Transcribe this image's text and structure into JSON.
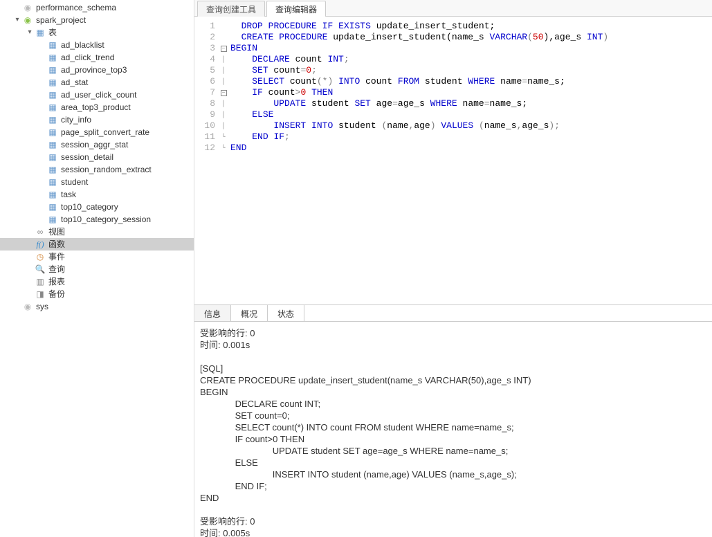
{
  "sidebar": {
    "nodes": [
      {
        "indent": 1,
        "toggle": "",
        "icon": "db-gray",
        "label": "performance_schema"
      },
      {
        "indent": 1,
        "toggle": "▾",
        "icon": "db",
        "label": "spark_project"
      },
      {
        "indent": 2,
        "toggle": "▾",
        "icon": "table-grp",
        "label": "表"
      },
      {
        "indent": 3,
        "toggle": "",
        "icon": "table",
        "label": "ad_blacklist"
      },
      {
        "indent": 3,
        "toggle": "",
        "icon": "table",
        "label": "ad_click_trend"
      },
      {
        "indent": 3,
        "toggle": "",
        "icon": "table",
        "label": "ad_province_top3"
      },
      {
        "indent": 3,
        "toggle": "",
        "icon": "table",
        "label": "ad_stat"
      },
      {
        "indent": 3,
        "toggle": "",
        "icon": "table",
        "label": "ad_user_click_count"
      },
      {
        "indent": 3,
        "toggle": "",
        "icon": "table",
        "label": "area_top3_product"
      },
      {
        "indent": 3,
        "toggle": "",
        "icon": "table",
        "label": "city_info"
      },
      {
        "indent": 3,
        "toggle": "",
        "icon": "table",
        "label": "page_split_convert_rate"
      },
      {
        "indent": 3,
        "toggle": "",
        "icon": "table",
        "label": "session_aggr_stat"
      },
      {
        "indent": 3,
        "toggle": "",
        "icon": "table",
        "label": "session_detail"
      },
      {
        "indent": 3,
        "toggle": "",
        "icon": "table",
        "label": "session_random_extract"
      },
      {
        "indent": 3,
        "toggle": "",
        "icon": "table",
        "label": "student"
      },
      {
        "indent": 3,
        "toggle": "",
        "icon": "table",
        "label": "task"
      },
      {
        "indent": 3,
        "toggle": "",
        "icon": "table",
        "label": "top10_category"
      },
      {
        "indent": 3,
        "toggle": "",
        "icon": "table",
        "label": "top10_category_session"
      },
      {
        "indent": 2,
        "toggle": "",
        "icon": "view",
        "label": "视图"
      },
      {
        "indent": 2,
        "toggle": "",
        "icon": "func",
        "label": "函数",
        "selected": true
      },
      {
        "indent": 2,
        "toggle": "",
        "icon": "event",
        "label": "事件"
      },
      {
        "indent": 2,
        "toggle": "",
        "icon": "query",
        "label": "查询"
      },
      {
        "indent": 2,
        "toggle": "",
        "icon": "report",
        "label": "报表"
      },
      {
        "indent": 2,
        "toggle": "",
        "icon": "backup",
        "label": "备份"
      },
      {
        "indent": 1,
        "toggle": "",
        "icon": "db-gray",
        "label": "sys"
      }
    ]
  },
  "topTabs": [
    {
      "label": "查询创建工具",
      "active": false
    },
    {
      "label": "查询编辑器",
      "active": true
    }
  ],
  "editor": {
    "lines": [
      {
        "n": 1,
        "fold": "",
        "tokens": [
          [
            "  ",
            "pl"
          ],
          [
            "DROP",
            "kw"
          ],
          [
            " ",
            "pl"
          ],
          [
            "PROCEDURE",
            "kw"
          ],
          [
            " ",
            "pl"
          ],
          [
            "IF",
            "kw"
          ],
          [
            " ",
            "pl"
          ],
          [
            "EXISTS",
            "kw"
          ],
          [
            " update_insert_student;",
            "id"
          ]
        ]
      },
      {
        "n": 2,
        "fold": "",
        "tokens": [
          [
            "  ",
            "pl"
          ],
          [
            "CREATE",
            "kw"
          ],
          [
            " ",
            "pl"
          ],
          [
            "PROCEDURE",
            "kw"
          ],
          [
            " update_insert_student(name_s ",
            "id"
          ],
          [
            "VARCHAR",
            "type"
          ],
          [
            "(",
            "op"
          ],
          [
            "50",
            "num"
          ],
          [
            "),age_s ",
            "id"
          ],
          [
            "INT",
            "type"
          ],
          [
            ")",
            "op"
          ]
        ]
      },
      {
        "n": 3,
        "fold": "box",
        "tokens": [
          [
            "BEGIN",
            "kw"
          ]
        ]
      },
      {
        "n": 4,
        "fold": "line",
        "tokens": [
          [
            "    ",
            "pl"
          ],
          [
            "DECLARE",
            "kw"
          ],
          [
            " count ",
            "id"
          ],
          [
            "INT",
            "type"
          ],
          [
            ";",
            "op"
          ]
        ]
      },
      {
        "n": 5,
        "fold": "line",
        "tokens": [
          [
            "    ",
            "pl"
          ],
          [
            "SET",
            "kw"
          ],
          [
            " count",
            "id"
          ],
          [
            "=",
            "op"
          ],
          [
            "0",
            "num"
          ],
          [
            ";",
            "op"
          ]
        ]
      },
      {
        "n": 6,
        "fold": "line",
        "tokens": [
          [
            "    ",
            "pl"
          ],
          [
            "SELECT",
            "kw"
          ],
          [
            " count",
            "id"
          ],
          [
            "(*) ",
            "op"
          ],
          [
            "INTO",
            "kw"
          ],
          [
            " count ",
            "id"
          ],
          [
            "FROM",
            "kw"
          ],
          [
            " student ",
            "id"
          ],
          [
            "WHERE",
            "kw"
          ],
          [
            " name",
            "id"
          ],
          [
            "=",
            "op"
          ],
          [
            "name_s;",
            "id"
          ]
        ]
      },
      {
        "n": 7,
        "fold": "box",
        "tokens": [
          [
            "    ",
            "pl"
          ],
          [
            "IF",
            "kw"
          ],
          [
            " count",
            "id"
          ],
          [
            ">",
            "op"
          ],
          [
            "0",
            "num"
          ],
          [
            " ",
            "pl"
          ],
          [
            "THEN",
            "kw"
          ]
        ]
      },
      {
        "n": 8,
        "fold": "line",
        "tokens": [
          [
            "        ",
            "pl"
          ],
          [
            "UPDATE",
            "kw"
          ],
          [
            " student ",
            "id"
          ],
          [
            "SET",
            "kw"
          ],
          [
            " age",
            "id"
          ],
          [
            "=",
            "op"
          ],
          [
            "age_s ",
            "id"
          ],
          [
            "WHERE",
            "kw"
          ],
          [
            " name",
            "id"
          ],
          [
            "=",
            "op"
          ],
          [
            "name_s;",
            "id"
          ]
        ]
      },
      {
        "n": 9,
        "fold": "line",
        "tokens": [
          [
            "    ",
            "pl"
          ],
          [
            "ELSE",
            "kw"
          ]
        ]
      },
      {
        "n": 10,
        "fold": "line",
        "tokens": [
          [
            "        ",
            "pl"
          ],
          [
            "INSERT",
            "kw"
          ],
          [
            " ",
            "pl"
          ],
          [
            "INTO",
            "kw"
          ],
          [
            " student ",
            "id"
          ],
          [
            "(",
            "op"
          ],
          [
            "name",
            "id"
          ],
          [
            ",",
            "op"
          ],
          [
            "age",
            "id"
          ],
          [
            ") ",
            "op"
          ],
          [
            "VALUES",
            "kw"
          ],
          [
            " ",
            "pl"
          ],
          [
            "(",
            "op"
          ],
          [
            "name_s",
            "id"
          ],
          [
            ",",
            "op"
          ],
          [
            "age_s",
            "id"
          ],
          [
            ")",
            "op"
          ],
          [
            ";",
            "op"
          ]
        ]
      },
      {
        "n": 11,
        "fold": "end",
        "tokens": [
          [
            "    ",
            "pl"
          ],
          [
            "END",
            "kw"
          ],
          [
            " ",
            "pl"
          ],
          [
            "IF",
            "kw"
          ],
          [
            ";",
            "op"
          ]
        ]
      },
      {
        "n": 12,
        "fold": "end",
        "tokens": [
          [
            "END",
            "kw"
          ]
        ]
      }
    ]
  },
  "resultTabs": [
    {
      "label": "信息",
      "active": true
    },
    {
      "label": "概况",
      "active": false
    },
    {
      "label": "状态",
      "active": false
    }
  ],
  "resultText": "受影响的行: 0\n时间: 0.001s\n\n[SQL]\nCREATE PROCEDURE update_insert_student(name_s VARCHAR(50),age_s INT)\nBEGIN\n              DECLARE count INT;\n              SET count=0;\n              SELECT count(*) INTO count FROM student WHERE name=name_s;\n              IF count>0 THEN\n                             UPDATE student SET age=age_s WHERE name=name_s;\n              ELSE\n                             INSERT INTO student (name,age) VALUES (name_s,age_s);\n              END IF;\nEND\n\n受影响的行: 0\n时间: 0.005s"
}
